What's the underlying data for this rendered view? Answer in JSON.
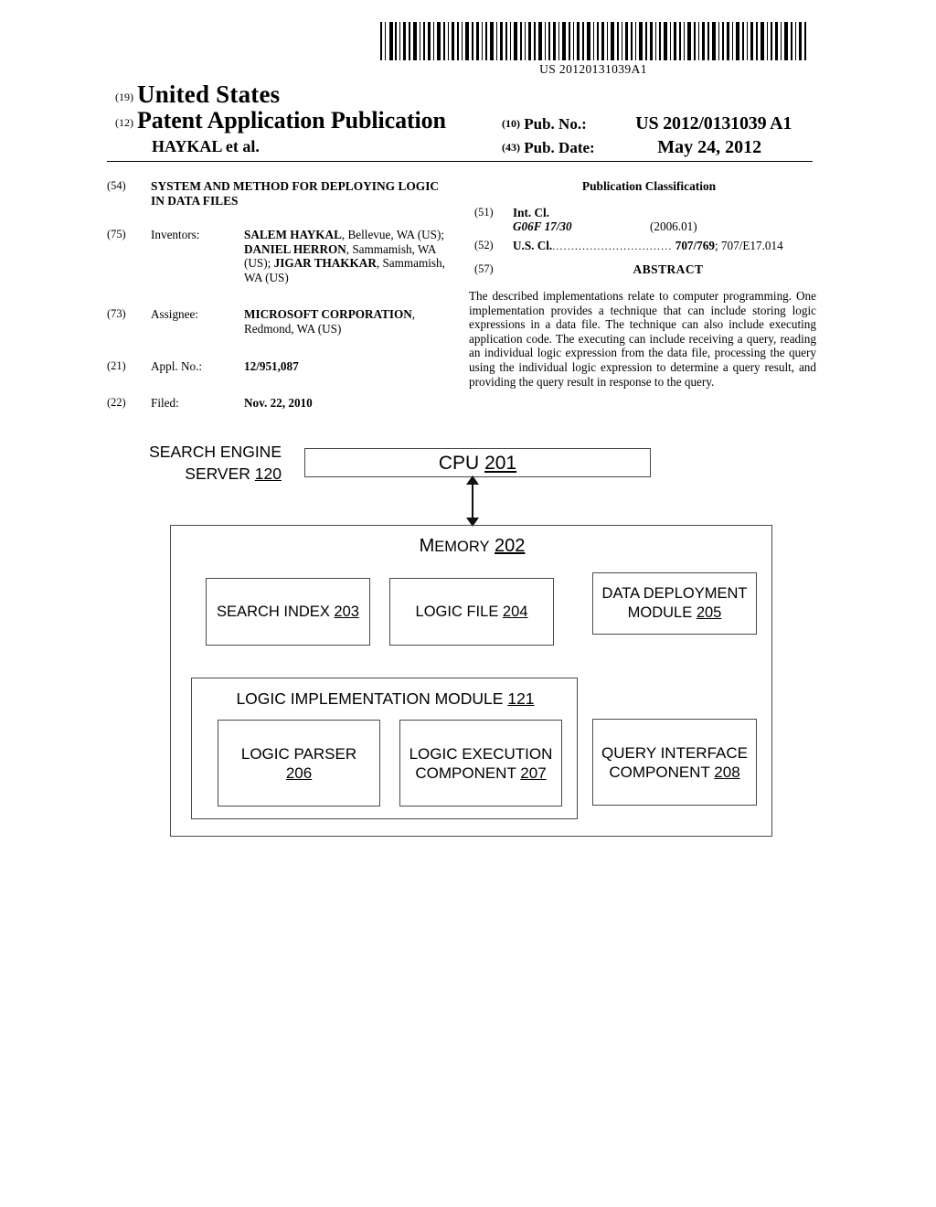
{
  "barcode": {
    "publication_number_text": "US 20120131039A1",
    "icon": "barcode-icon"
  },
  "masthead": {
    "country_code": "(19)",
    "country": "United States",
    "doc_type_code": "(12)",
    "doc_type": "Patent Application Publication",
    "authors": "HAYKAL et al.",
    "pub_no_code": "(10)",
    "pub_no_label": "Pub. No.:",
    "pub_no_value": "US 2012/0131039 A1",
    "pub_date_code": "(43)",
    "pub_date_label": "Pub. Date:",
    "pub_date_value": "May 24, 2012"
  },
  "left_column": {
    "title_code": "(54)",
    "title": "SYSTEM AND METHOD FOR DEPLOYING LOGIC IN DATA FILES",
    "inventors_code": "(75)",
    "inventors_label": "Inventors:",
    "inventors_value": "SALEM HAYKAL, Bellevue, WA (US); DANIEL HERRON, Sammamish, WA (US); JIGAR THAKKAR, Sammamish, WA (US)",
    "inventor_1_name": "SALEM HAYKAL",
    "inventor_1_loc": ", Bellevue, WA (US); ",
    "inventor_2_name": "DANIEL HERRON",
    "inventor_2_loc": ", Sammamish, WA (US); ",
    "inventor_3_name": "JIGAR THAKKAR",
    "inventor_3_loc": ", Sammamish, WA (US)",
    "assignee_code": "(73)",
    "assignee_label": "Assignee:",
    "assignee_name": "MICROSOFT CORPORATION",
    "assignee_loc": ", Redmond, WA (US)",
    "appl_no_code": "(21)",
    "appl_no_label": "Appl. No.:",
    "appl_no_value": "12/951,087",
    "filed_code": "(22)",
    "filed_label": "Filed:",
    "filed_value": "Nov. 22, 2010"
  },
  "right_column": {
    "classification_heading": "Publication Classification",
    "int_cl_code": "(51)",
    "int_cl_label": "Int. Cl.",
    "int_cl_value": "G06F 17/30",
    "int_cl_version": "(2006.01)",
    "us_cl_code": "(52)",
    "us_cl_label": "U.S. Cl.",
    "us_cl_leader": "................................",
    "us_cl_primary": "707/769",
    "us_cl_secondary": "; 707/E17.014",
    "abstract_code": "(57)",
    "abstract_heading": "ABSTRACT",
    "abstract_text": "The described implementations relate to computer programming. One implementation provides a technique that can include storing logic expressions in a data file. The technique can also include executing application code. The executing can include receiving a query, reading an individual logic expression from the data file, processing the query using the individual logic expression to determine a query result, and providing the query result in response to the query."
  },
  "figure": {
    "server_label_line1": "SEARCH ENGINE",
    "server_label_line2": "SERVER",
    "server_ref": "120",
    "cpu_label": "CPU",
    "cpu_ref": "201",
    "memory_label_first": "M",
    "memory_label_rest": "EMORY",
    "memory_ref": "202",
    "search_index_label": "SEARCH INDEX",
    "search_index_ref": "203",
    "logic_file_label": "LOGIC FILE",
    "logic_file_ref": "204",
    "data_deployment_line1": "DATA DEPLOYMENT",
    "data_deployment_line2": "MODULE",
    "data_deployment_ref": "205",
    "lim_label": "LOGIC IMPLEMENTATION MODULE",
    "lim_ref": "121",
    "logic_parser_label": "LOGIC PARSER",
    "logic_parser_ref": "206",
    "logic_exec_line1": "LOGIC EXECUTION",
    "logic_exec_line2": "COMPONENT",
    "logic_exec_ref": "207",
    "query_iface_line1": "QUERY INTERFACE",
    "query_iface_line2": "COMPONENT",
    "query_iface_ref": "208",
    "arrow": "bidirectional-arrow-icon"
  }
}
